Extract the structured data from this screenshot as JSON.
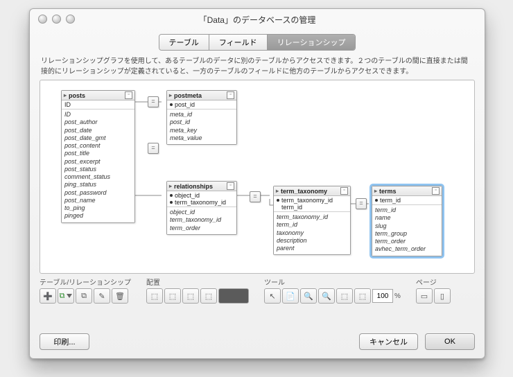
{
  "window": {
    "title": "「Data」のデータベースの管理"
  },
  "tabs": [
    "テーブル",
    "フィールド",
    "リレーションシップ"
  ],
  "active_tab": 2,
  "description": "リレーションシップグラフを使用して、あるテーブルのデータに別のテーブルからアクセスできます。２つのテーブルの間に直接または間接的にリレーションシップが定義されていると、一方のテーブルのフィールドに他方のテーブルからアクセスできます。",
  "join_symbol": "=",
  "tables": {
    "posts": {
      "name": "posts",
      "key": "ID",
      "fields": [
        "ID",
        "post_author",
        "post_date",
        "post_date_gmt",
        "post_content",
        "post_title",
        "post_excerpt",
        "post_status",
        "comment_status",
        "ping_status",
        "post_password",
        "post_name",
        "to_ping",
        "pinged"
      ]
    },
    "postmeta": {
      "name": "postmeta",
      "key": "post_id",
      "fields": [
        "meta_id",
        "post_id",
        "meta_key",
        "meta_value"
      ]
    },
    "relationships": {
      "name": "relationships",
      "keys": [
        "object_id",
        "term_taxonomy_id"
      ],
      "fields": [
        "object_id",
        "term_taxonomy_id",
        "term_order"
      ]
    },
    "term_taxonomy": {
      "name": "term_taxonomy",
      "keys": [
        "term_taxonomy_id",
        "term_id"
      ],
      "fields": [
        "term_taxonomy_id",
        "term_id",
        "taxonomy",
        "description",
        "parent"
      ]
    },
    "terms": {
      "name": "terms",
      "key": "term_id",
      "selected": true,
      "fields": [
        "term_id",
        "name",
        "slug",
        "term_group",
        "term_order",
        "avhec_term_order"
      ]
    }
  },
  "toolbar": {
    "groups": [
      "テーブル/リレーションシップ",
      "配置",
      "ツール",
      "ページ"
    ],
    "zoom_value": "100",
    "zoom_pct": "%"
  },
  "footer": {
    "print": "印刷...",
    "cancel": "キャンセル",
    "ok": "OK"
  }
}
